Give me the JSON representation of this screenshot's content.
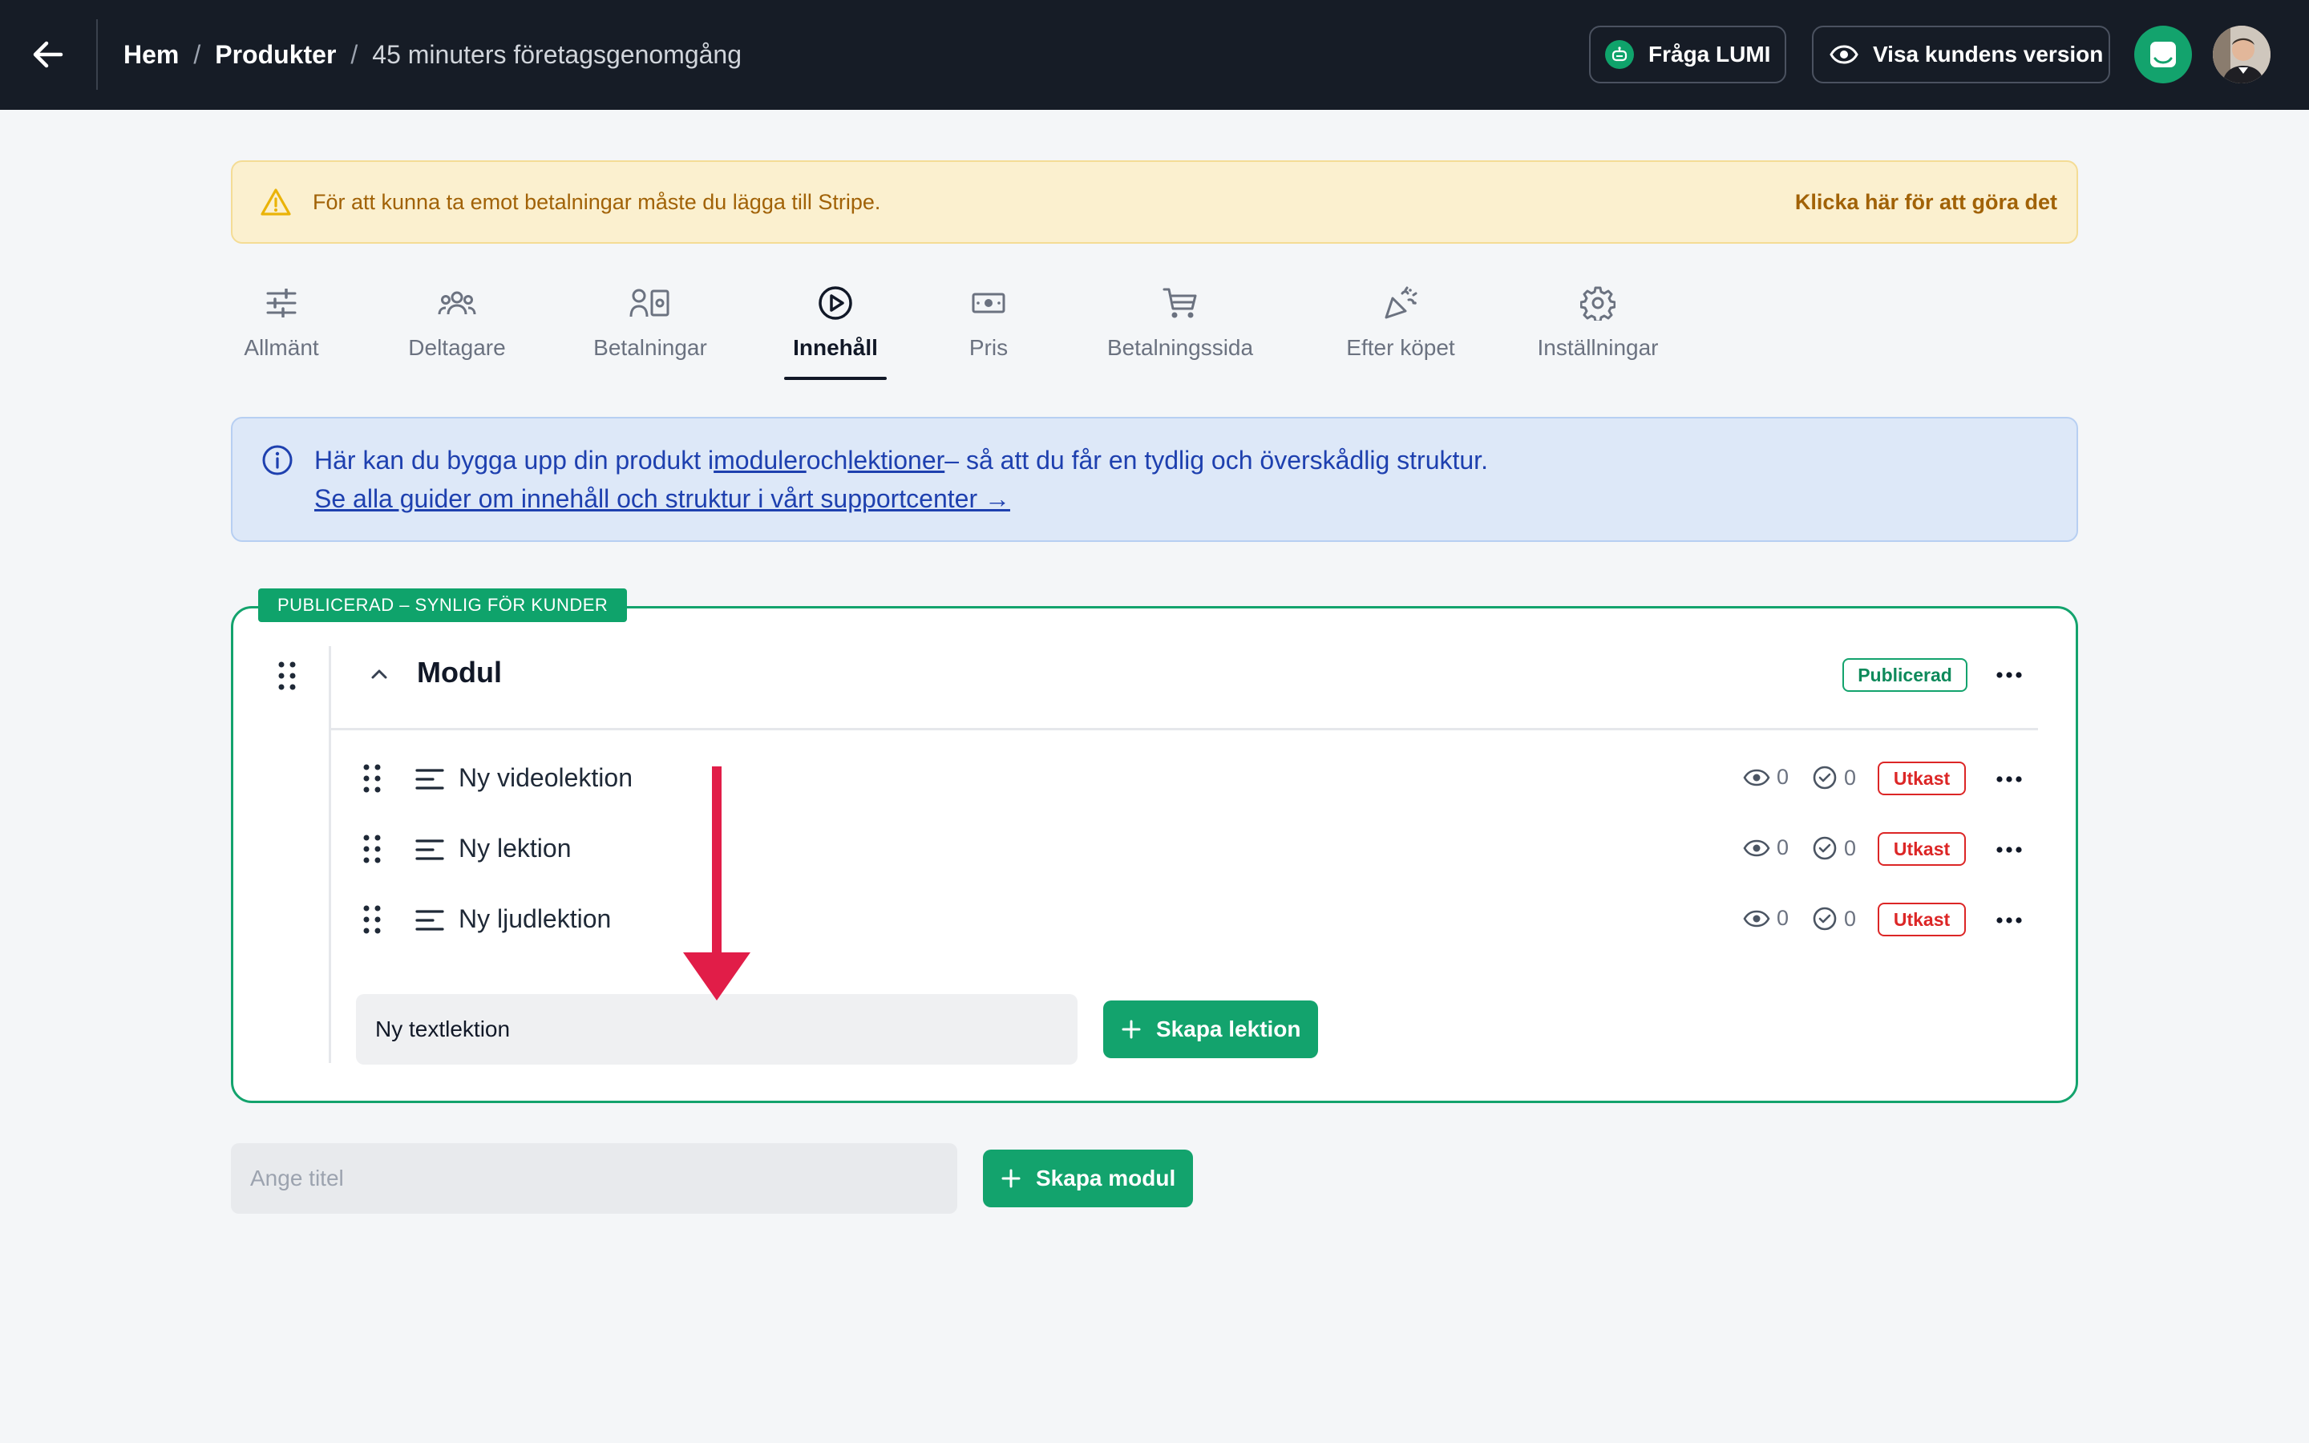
{
  "header": {
    "breadcrumb": [
      "Hem",
      "Produkter",
      "45 minuters företagsgenomgång"
    ],
    "ask_lumi_label": "Fråga LUMI",
    "customer_view_label": "Visa kundens version"
  },
  "alert": {
    "message": "För att kunna ta emot betalningar måste du lägga till Stripe.",
    "action_label": "Klicka här för att göra det"
  },
  "tabs": [
    {
      "label": "Allmänt",
      "icon": "sliders-icon",
      "active": false
    },
    {
      "label": "Deltagare",
      "icon": "users-icon",
      "active": false
    },
    {
      "label": "Betalningar",
      "icon": "payments-icon",
      "active": false
    },
    {
      "label": "Innehåll",
      "icon": "play-circle-icon",
      "active": true
    },
    {
      "label": "Pris",
      "icon": "money-icon",
      "active": false
    },
    {
      "label": "Betalningssida",
      "icon": "cart-icon",
      "active": false
    },
    {
      "label": "Efter köpet",
      "icon": "party-popper-icon",
      "active": false
    },
    {
      "label": "Inställningar",
      "icon": "gear-icon",
      "active": false
    }
  ],
  "info": {
    "prefix": "Här kan du bygga upp din produkt i",
    "link_modules": "moduler",
    "and": "och",
    "link_lessons": "lektioner",
    "suffix": "– så att du får en tydlig och överskådlig struktur.",
    "guide_link": "Se alla guider om innehåll och struktur i vårt supportcenter →"
  },
  "module": {
    "status_tag": "PUBLICERAD – SYNLIG FÖR KUNDER",
    "title": "Modul",
    "badge": "Publicerad",
    "lessons": [
      {
        "title": "Ny videolektion",
        "views": "0",
        "completed": "0",
        "status": "Utkast"
      },
      {
        "title": "Ny lektion",
        "views": "0",
        "completed": "0",
        "status": "Utkast"
      },
      {
        "title": "Ny ljudlektion",
        "views": "0",
        "completed": "0",
        "status": "Utkast"
      }
    ],
    "new_lesson_value": "Ny textlektion",
    "create_lesson_label": "Skapa lektion"
  },
  "new_module": {
    "placeholder": "Ange titel",
    "create_label": "Skapa modul"
  },
  "colors": {
    "topbar": "#161c26",
    "brand_green": "#13a36d",
    "draft_red": "#dc2626",
    "arrow_red": "#e11d48"
  }
}
